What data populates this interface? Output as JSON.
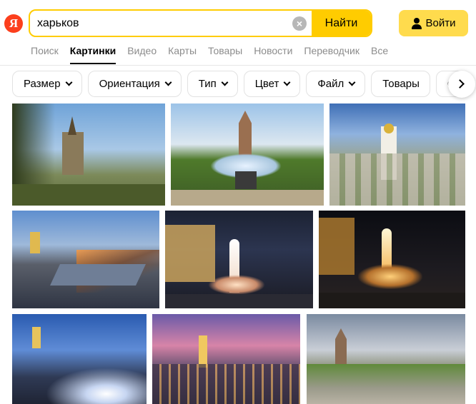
{
  "logo": {
    "letter": "Я"
  },
  "search": {
    "query": "харьков",
    "submit_label": "Найти"
  },
  "login": {
    "label": "Войти"
  },
  "nav_tabs": [
    "Поиск",
    "Картинки",
    "Видео",
    "Карты",
    "Товары",
    "Новости",
    "Переводчик",
    "Все"
  ],
  "active_tab": "Картинки",
  "filters": [
    "Размер",
    "Ориентация",
    "Тип",
    "Цвет",
    "Файл",
    "Товары",
    "С"
  ],
  "icons": {
    "clear": "clear-icon",
    "user": "user-icon",
    "next": "chevron-right-icon"
  },
  "colors": {
    "accent": "#ffcc00",
    "logo": "#fc3f1d",
    "login": "#ffdb4d"
  }
}
